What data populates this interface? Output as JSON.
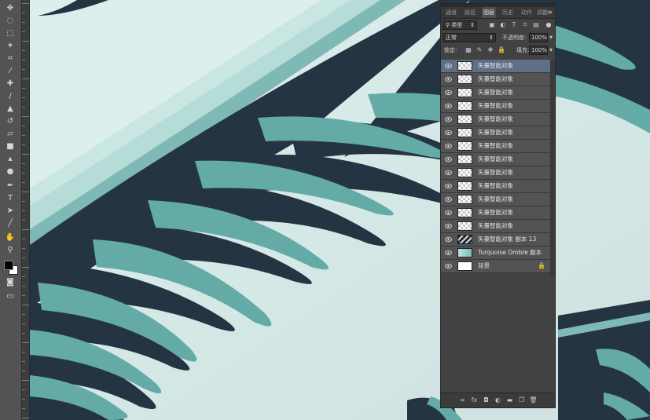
{
  "tools": [
    {
      "name": "move-tool-icon",
      "glyph": "✥"
    },
    {
      "name": "lasso-tool-icon",
      "glyph": "◌"
    },
    {
      "name": "marquee-tool-icon",
      "glyph": "⬚"
    },
    {
      "name": "magic-wand-tool-icon",
      "glyph": "✶"
    },
    {
      "name": "crop-tool-icon",
      "glyph": "⌗"
    },
    {
      "name": "eyedropper-tool-icon",
      "glyph": "⁄"
    },
    {
      "name": "healing-brush-tool-icon",
      "glyph": "✚"
    },
    {
      "name": "brush-tool-icon",
      "glyph": "/"
    },
    {
      "name": "clone-stamp-tool-icon",
      "glyph": "▲"
    },
    {
      "name": "history-brush-tool-icon",
      "glyph": "↺"
    },
    {
      "name": "eraser-tool-icon",
      "glyph": "▱"
    },
    {
      "name": "gradient-tool-icon",
      "glyph": "■"
    },
    {
      "name": "blur-tool-icon",
      "glyph": "▴"
    },
    {
      "name": "dodge-tool-icon",
      "glyph": "●"
    },
    {
      "name": "pen-tool-icon",
      "glyph": "✒"
    },
    {
      "name": "type-tool-icon",
      "glyph": "T"
    },
    {
      "name": "path-selection-tool-icon",
      "glyph": "➤"
    },
    {
      "name": "line-tool-icon",
      "glyph": "╱"
    },
    {
      "name": "hand-tool-icon",
      "glyph": "✋"
    },
    {
      "name": "zoom-tool-icon",
      "glyph": "⚲"
    }
  ],
  "colors": {
    "foreground": "#000000",
    "background": "#ffffff"
  },
  "layers_panel": {
    "tabs": [
      "通道",
      "路径",
      "图层",
      "历史",
      "动作",
      "调整"
    ],
    "active_tab": "图层",
    "filter_kind": "类型",
    "blend_mode": "正常",
    "opacity_label": "不透明度:",
    "opacity_value": "100%",
    "lock_label": "锁定:",
    "fill_label": "填充:",
    "fill_value": "100%",
    "layers": [
      {
        "name": "矢量智能对象",
        "thumb": "trans",
        "selected": true
      },
      {
        "name": "矢量智能对象",
        "thumb": "trans"
      },
      {
        "name": "矢量智能对象",
        "thumb": "trans"
      },
      {
        "name": "矢量智能对象",
        "thumb": "trans"
      },
      {
        "name": "矢量智能对象",
        "thumb": "trans"
      },
      {
        "name": "矢量智能对象",
        "thumb": "trans"
      },
      {
        "name": "矢量智能对象",
        "thumb": "trans"
      },
      {
        "name": "矢量智能对象",
        "thumb": "trans"
      },
      {
        "name": "矢量智能对象",
        "thumb": "trans"
      },
      {
        "name": "矢量智能对象",
        "thumb": "trans"
      },
      {
        "name": "矢量智能对象",
        "thumb": "trans"
      },
      {
        "name": "矢量智能对象",
        "thumb": "trans"
      },
      {
        "name": "矢量智能对象",
        "thumb": "trans"
      },
      {
        "name": "矢量智能对象 副本 13",
        "thumb": "dark"
      },
      {
        "name": "Turquoise Ombre 副本",
        "thumb": "turq"
      },
      {
        "name": "背景",
        "thumb": "white",
        "locked": true
      }
    ]
  },
  "footer_icons": [
    "link-layers-icon",
    "fx-icon",
    "add-mask-icon",
    "adjustment-layer-icon",
    "new-group-icon",
    "new-layer-icon",
    "delete-layer-icon"
  ]
}
